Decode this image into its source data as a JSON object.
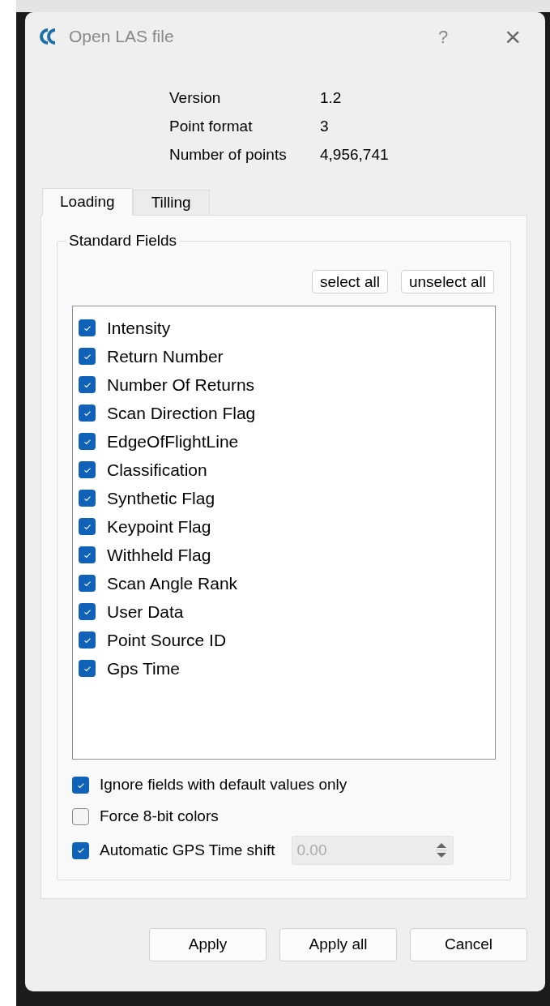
{
  "window": {
    "title": "Open LAS file",
    "help": "?",
    "close": "×"
  },
  "info": [
    {
      "label": "Version",
      "value": "1.2"
    },
    {
      "label": "Point format",
      "value": "3"
    },
    {
      "label": "Number of points",
      "value": "4,956,741"
    }
  ],
  "tabs": [
    {
      "label": "Loading",
      "selected": true
    },
    {
      "label": "Tilling",
      "selected": false
    }
  ],
  "group": {
    "title": "Standard Fields",
    "buttons": [
      "select all",
      "unselect all"
    ],
    "fields": [
      {
        "label": "Intensity",
        "checked": true
      },
      {
        "label": "Return Number",
        "checked": true
      },
      {
        "label": "Number Of Returns",
        "checked": true
      },
      {
        "label": "Scan Direction Flag",
        "checked": true
      },
      {
        "label": "EdgeOfFlightLine",
        "checked": true
      },
      {
        "label": "Classification",
        "checked": true
      },
      {
        "label": "Synthetic Flag",
        "checked": true
      },
      {
        "label": "Keypoint Flag",
        "checked": true
      },
      {
        "label": "Withheld Flag",
        "checked": true
      },
      {
        "label": "Scan Angle Rank",
        "checked": true
      },
      {
        "label": "User Data",
        "checked": true
      },
      {
        "label": "Point Source ID",
        "checked": true
      },
      {
        "label": "Gps Time",
        "checked": true
      }
    ],
    "options": [
      {
        "label": "Ignore fields with default values only",
        "checked": true
      },
      {
        "label": "Force 8-bit colors",
        "checked": false
      },
      {
        "label": "Automatic GPS Time shift",
        "checked": true,
        "spin_value": "0.00"
      }
    ]
  },
  "buttons": [
    "Apply",
    "Apply all",
    "Cancel"
  ]
}
